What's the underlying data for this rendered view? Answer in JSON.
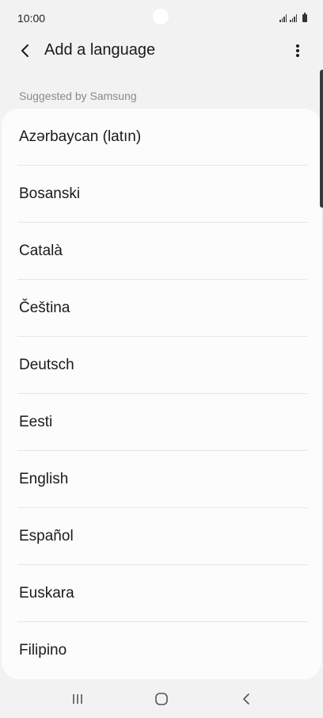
{
  "status_bar": {
    "time": "10:00"
  },
  "app_bar": {
    "title": "Add a language",
    "back_icon": "chevron-left-icon",
    "more_icon": "more-vertical-icon"
  },
  "section": {
    "header": "Suggested by Samsung"
  },
  "languages": [
    "Azərbaycan (latın)",
    "Bosanski",
    "Català",
    "Čeština",
    "Deutsch",
    "Eesti",
    "English",
    "Español",
    "Euskara",
    "Filipino"
  ],
  "nav_bar": {
    "recents_icon": "recents-icon",
    "home_icon": "home-icon",
    "back_icon": "back-icon"
  }
}
